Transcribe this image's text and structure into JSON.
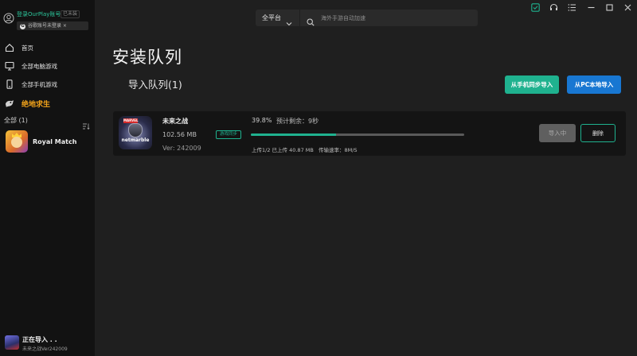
{
  "colors": {
    "accent": "#1fb28f",
    "blue": "#1877d2",
    "highlight": "#f2a31b",
    "background": "#1f1f1f",
    "sidebar": "#121212"
  },
  "account": {
    "login_label": "登录OurPlay账号",
    "tag": "已未装",
    "hint": "谷歌账号未登录 ×",
    "hint_icon": "G"
  },
  "sidebar": {
    "items": [
      {
        "label": "首页",
        "icon": "home-icon"
      },
      {
        "label": "全部电脑游戏",
        "icon": "monitor-icon"
      },
      {
        "label": "全部手机游戏",
        "icon": "phone-icon"
      },
      {
        "label": "绝地求生",
        "icon": "pubg-icon"
      }
    ],
    "all_label": "全部 (1)",
    "games": [
      {
        "name": "Royal Match"
      }
    ],
    "importing": {
      "title": "正在导入 . .",
      "subtitle": "未来之战Ver242009"
    }
  },
  "topbar": {
    "platform": "全平台",
    "search_placeholder": "海外手游自动加速"
  },
  "main": {
    "title": "安装队列",
    "queue_title": "导入队列(1)",
    "btn_phone_sync": "从手机同步导入",
    "btn_pc_import": "从PC本地导入",
    "item": {
      "name": "未来之战",
      "size": "102.56 MB",
      "version": "Ver: 242009",
      "sync_tag": "游戏同步",
      "icon_brand": "MARVEL",
      "icon_text": "netmarble",
      "percent_text": "39.8%",
      "progress": 0.398,
      "eta": "预计剩余：9秒",
      "uploaded": "上传1/2 已上传 40.87 MB",
      "speed": "传输速率：8M/S",
      "btn_importing": "导入中",
      "btn_delete": "删除"
    }
  }
}
